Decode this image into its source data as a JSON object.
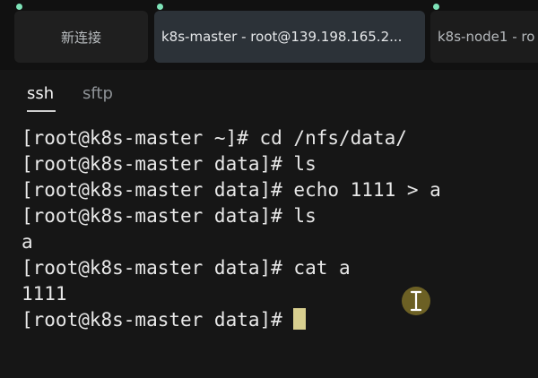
{
  "tabs": [
    {
      "label": "新连接",
      "active": false
    },
    {
      "label": "k8s-master - root@139.198.165.2...",
      "active": true
    },
    {
      "label": "k8s-node1 - ro",
      "active": false
    }
  ],
  "subtabs": [
    {
      "label": "ssh",
      "active": true
    },
    {
      "label": "sftp",
      "active": false
    }
  ],
  "terminal": {
    "lines": [
      "[root@k8s-master ~]# cd /nfs/data/",
      "[root@k8s-master data]# ls",
      "[root@k8s-master data]# echo 1111 > a",
      "[root@k8s-master data]# ls",
      "a",
      "[root@k8s-master data]# cat a",
      "1111",
      "[root@k8s-master data]# "
    ]
  },
  "colors": {
    "status_dot": "#7ee3b8",
    "cursor": "#d8cf8f",
    "terminal_bg": "#161616",
    "active_tab_bg": "#2c3238"
  },
  "icons": {
    "mouse_cursor": "text-cursor-icon"
  }
}
